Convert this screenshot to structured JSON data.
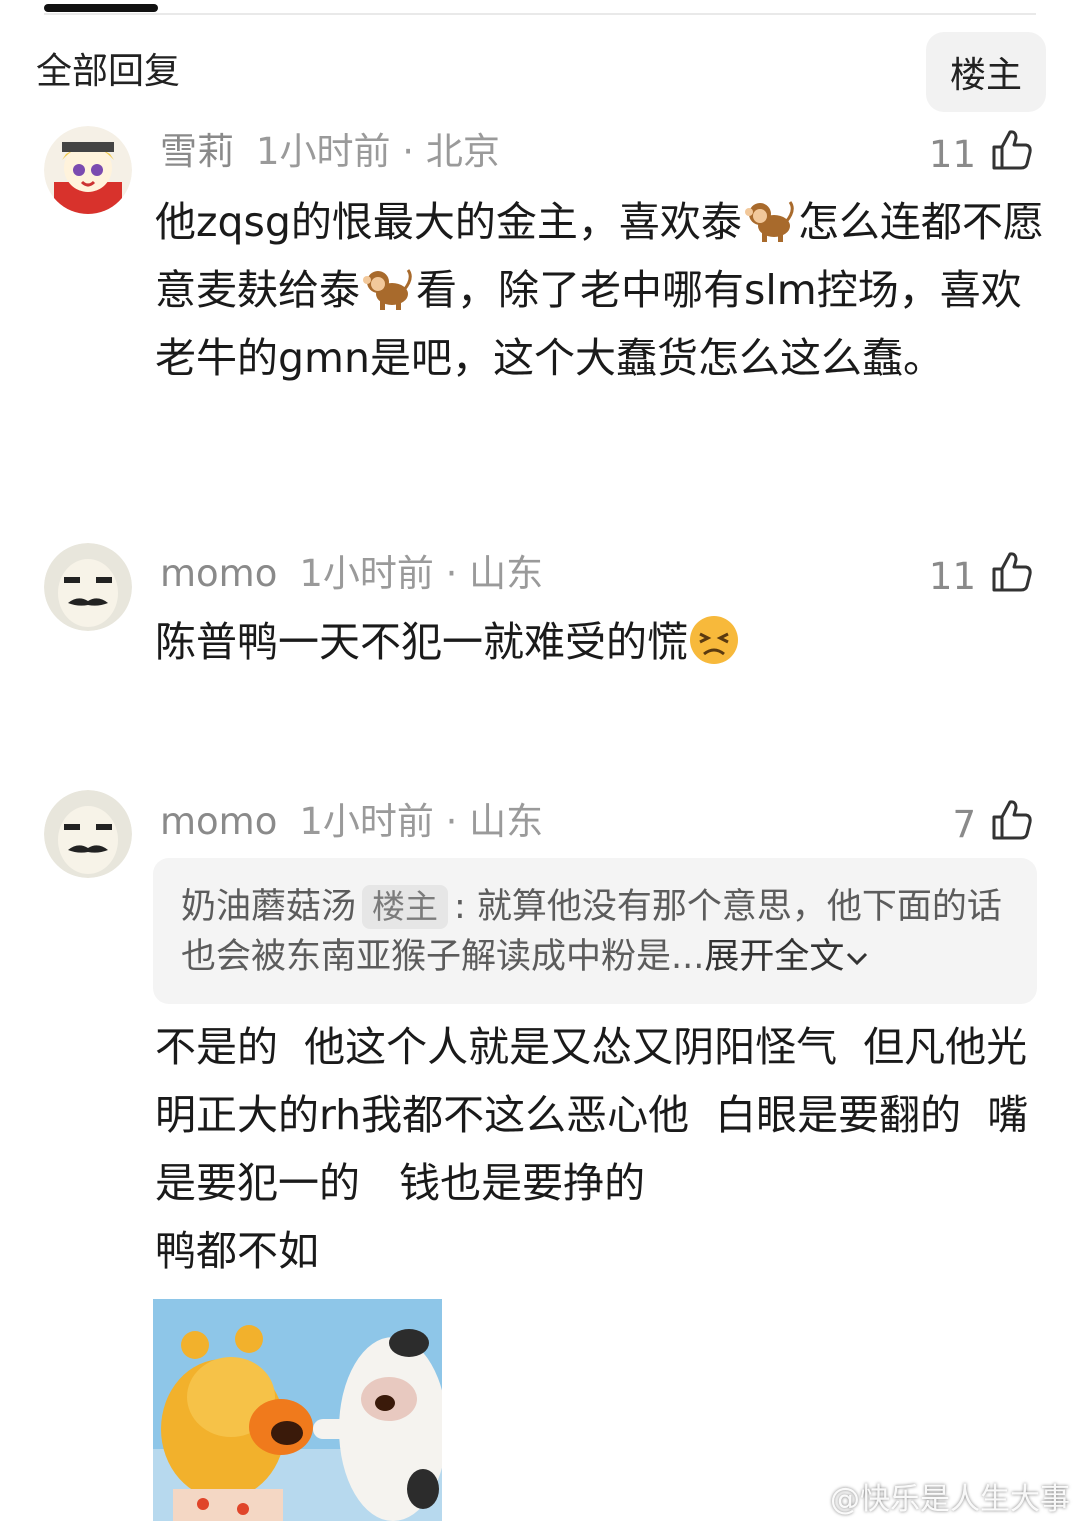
{
  "header": {
    "section_title": "全部回复",
    "filter_button": "楼主"
  },
  "comments": [
    {
      "user": "雪莉",
      "time_location": "1小时前 · 北京",
      "likes": "11",
      "text_parts": [
        "他zqsg的恨最大的金主，喜欢泰",
        "怎么连都不愿意麦麸给泰",
        "看，除了老中哪有slm控场，喜欢老牛的gmn是吧，这个大蠢货怎么这么蠢。"
      ]
    },
    {
      "user": "momo",
      "time_location": "1小时前 · 山东",
      "likes": "11",
      "text": "陈普鸭一天不犯一就难受的慌"
    },
    {
      "user": "momo",
      "time_location": "1小时前 · 山东",
      "likes": "7",
      "quote": {
        "author": "奶油蘑菇汤",
        "tag": "楼主",
        "text": ":  就算他没有那个意思，他下面的话也会被东南亚猴子解读成中粉是...",
        "expand_label": "展开全文"
      },
      "text": "不是的  他这个人就是又怂又阴阳怪气  但凡他光明正大的rh我都不这么恶心他  白眼是要翻的  嘴是要犯一的   钱也是要挣的\n鸭都不如"
    }
  ],
  "watermark": "@快乐是人生大事",
  "icons": {
    "like": "thumbs-up-icon",
    "monkey": "monkey-emoji",
    "face": "persevering-face-emoji",
    "expand": "chevron-down-icon"
  }
}
